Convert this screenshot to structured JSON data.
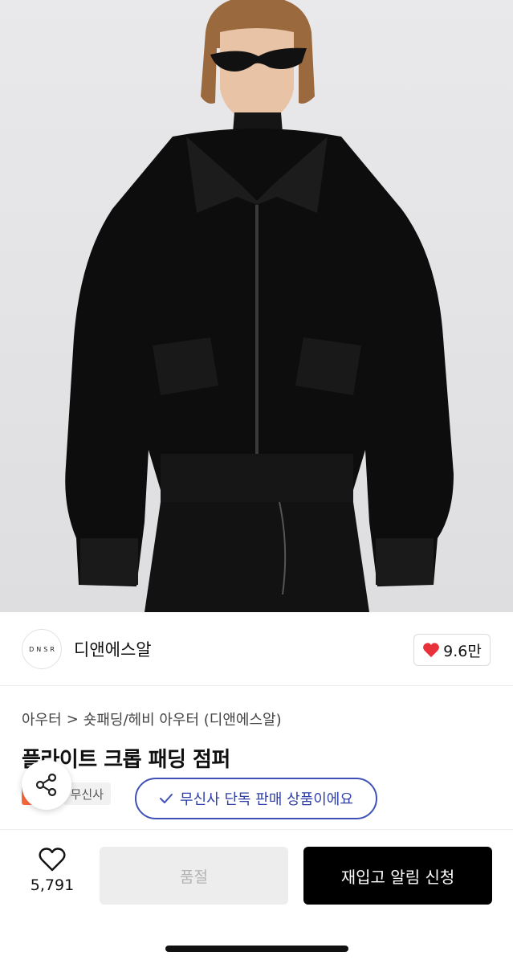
{
  "product_image": {
    "alt": ""
  },
  "brand": {
    "logo_text": "DNSR",
    "name": "디앤에스알",
    "like_count": "9.6만"
  },
  "breadcrumb": {
    "category": "아우터",
    "separator": ">",
    "subcategory": "숏패딩/헤비 아우터 (디앤에스알)"
  },
  "product": {
    "title": "플라이트 크롭 패딩 점퍼"
  },
  "tags": {
    "sale": "세일",
    "exclusive": "무신사"
  },
  "tooltip": {
    "text": "무신사 단독 판매 상품이에요"
  },
  "bottom_bar": {
    "wish_count": "5,791",
    "soldout_label": "품절",
    "restock_label": "재입고 알림 신청"
  },
  "colors": {
    "accent_blue": "#3f51b5",
    "heart_red": "#e8313a",
    "sale_orange": "#ff6a3d"
  },
  "icons": [
    "heart-icon",
    "share-icon",
    "check-icon",
    "heart-outline-icon"
  ]
}
